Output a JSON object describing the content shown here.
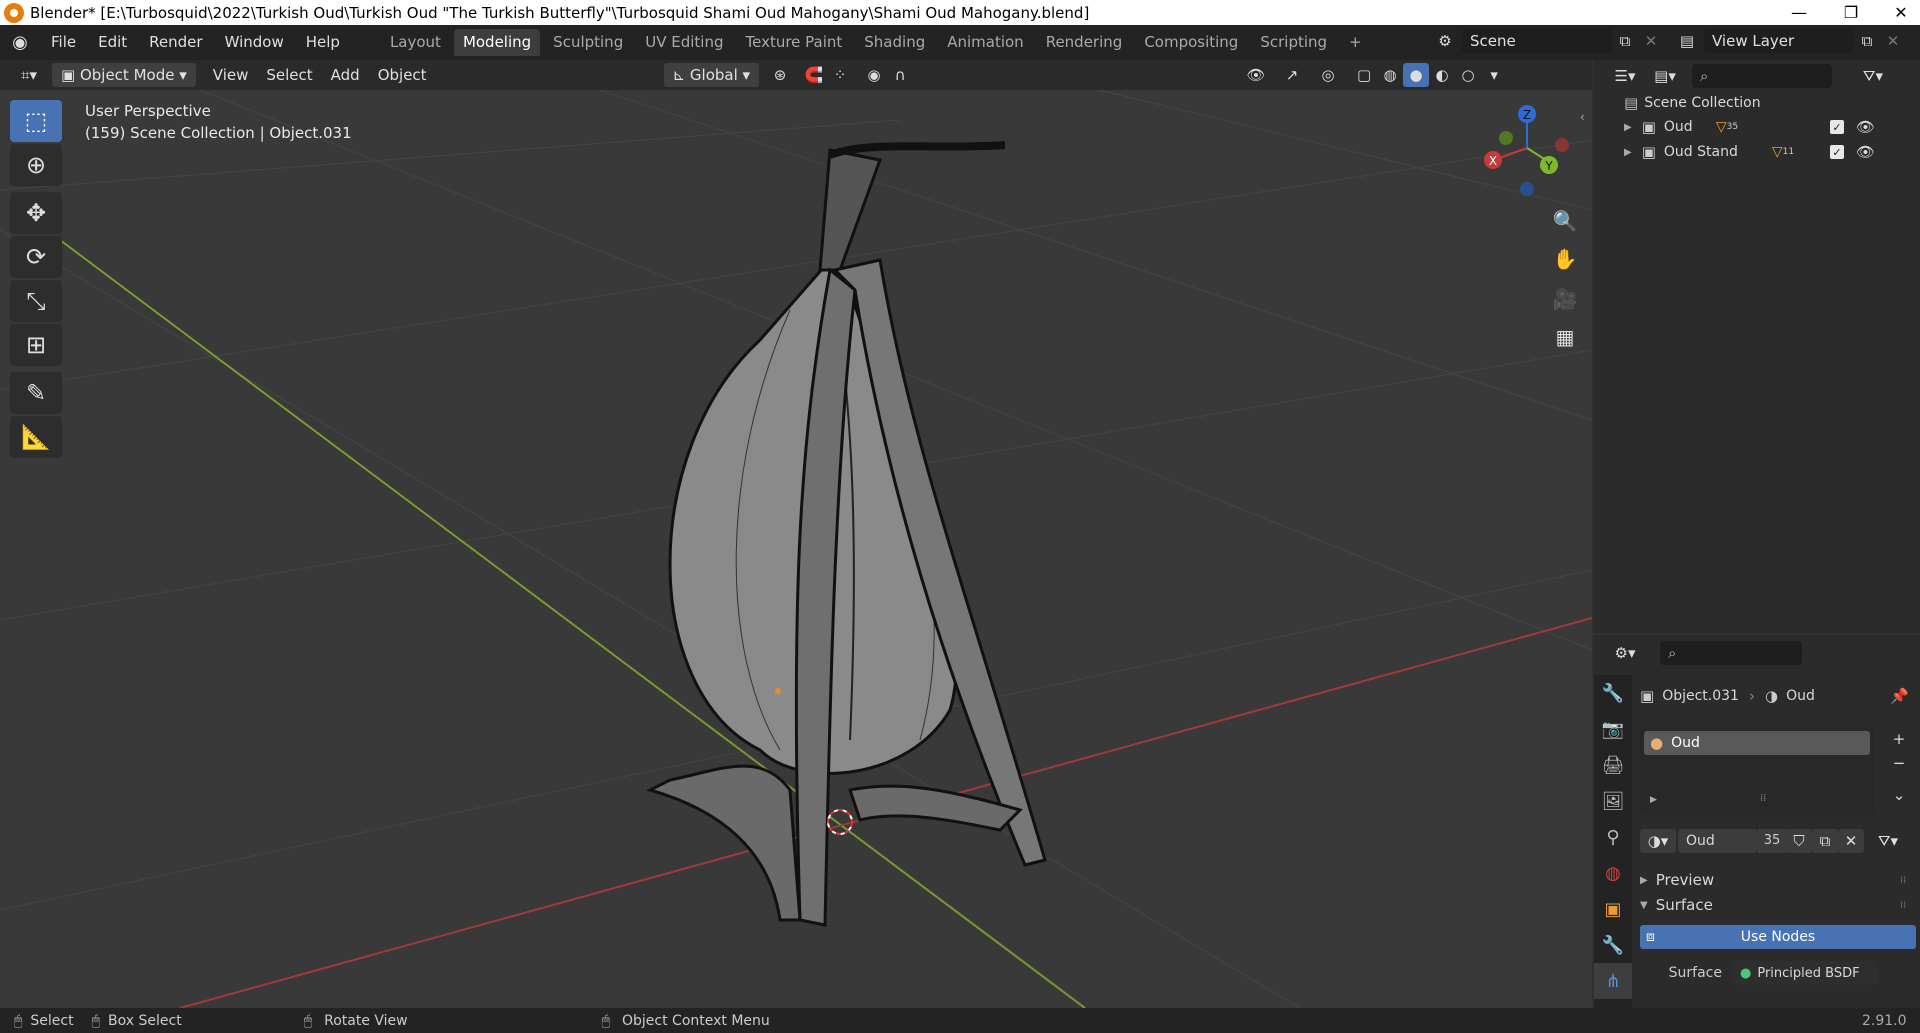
{
  "window": {
    "title": "Blender* [E:\\Turbosquid\\2022\\Turkish Oud\\Turkish Oud \"The Turkish Butterfly\"\\Turbosquid Shami Oud Mahogany\\Shami Oud Mahogany.blend]"
  },
  "menus": [
    "File",
    "Edit",
    "Render",
    "Window",
    "Help"
  ],
  "workspaces": [
    "Layout",
    "Modeling",
    "Sculpting",
    "UV Editing",
    "Texture Paint",
    "Shading",
    "Animation",
    "Rendering",
    "Compositing",
    "Scripting"
  ],
  "scene": {
    "name": "Scene",
    "view_layer": "View Layer"
  },
  "viewport_header": {
    "mode": "Object Mode",
    "view": "View",
    "select": "Select",
    "add": "Add",
    "object": "Object",
    "orientation": "Global"
  },
  "viewport": {
    "perspective": "User Perspective",
    "info": "(159) Scene Collection | Object.031",
    "gizmo": {
      "x": "X",
      "y": "Y",
      "z": "Z"
    }
  },
  "outliner": {
    "root": "Scene Collection",
    "items": [
      {
        "name": "Oud",
        "count": "35"
      },
      {
        "name": "Oud Stand",
        "count": "11"
      }
    ]
  },
  "properties": {
    "object": "Object.031",
    "material_context": "Oud",
    "slot": "Oud",
    "material_name": "Oud",
    "users": "35",
    "preview": "Preview",
    "surface": "Surface",
    "use_nodes": "Use Nodes",
    "surface_label": "Surface",
    "shader": "Principled BSDF"
  },
  "statusbar": {
    "select": "Select",
    "box_select": "Box Select",
    "rotate": "Rotate View",
    "context_menu": "Object Context Menu",
    "version": "2.91.0"
  },
  "colors": {
    "accent": "#4772b3",
    "x_axis": "#c83a3a",
    "y_axis": "#7fb92b",
    "z_axis": "#2d6bd8"
  }
}
